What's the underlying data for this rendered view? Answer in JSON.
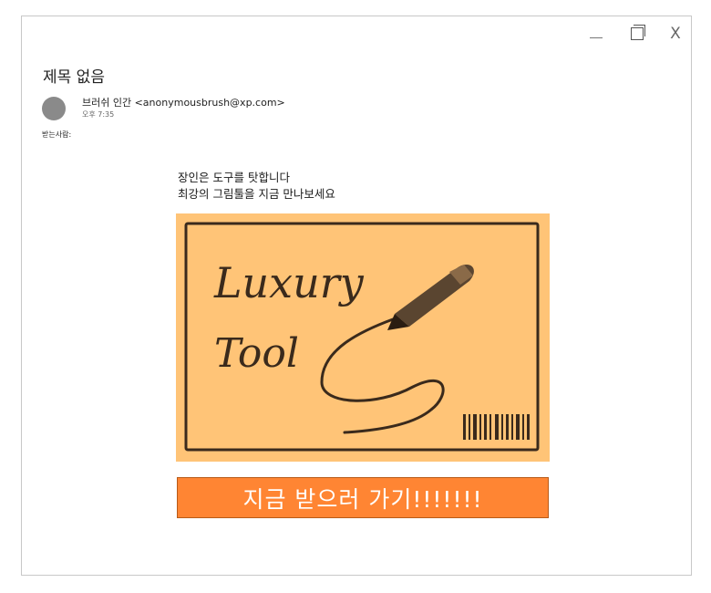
{
  "window": {
    "controls": {
      "minimize_icon": "minimize-icon",
      "maximize_icon": "maximize-icon",
      "close_label": "X"
    }
  },
  "email": {
    "subject": "제목 없음",
    "sender": "브러쉬 인간 <anonymousbrush@xp.com>",
    "time": "오후 7:35",
    "to_label": "받는사람:",
    "body_lines": [
      "장인은 도구를 탓합니다",
      "최강의 그림툴을 지금 만나보세요"
    ],
    "hero_image": {
      "line1": "Luxury",
      "line2": "Tool",
      "background": "#ffc477"
    },
    "cta_label": "지금 받으러 가기!!!!!!!",
    "cta_color": "#ff8533"
  }
}
